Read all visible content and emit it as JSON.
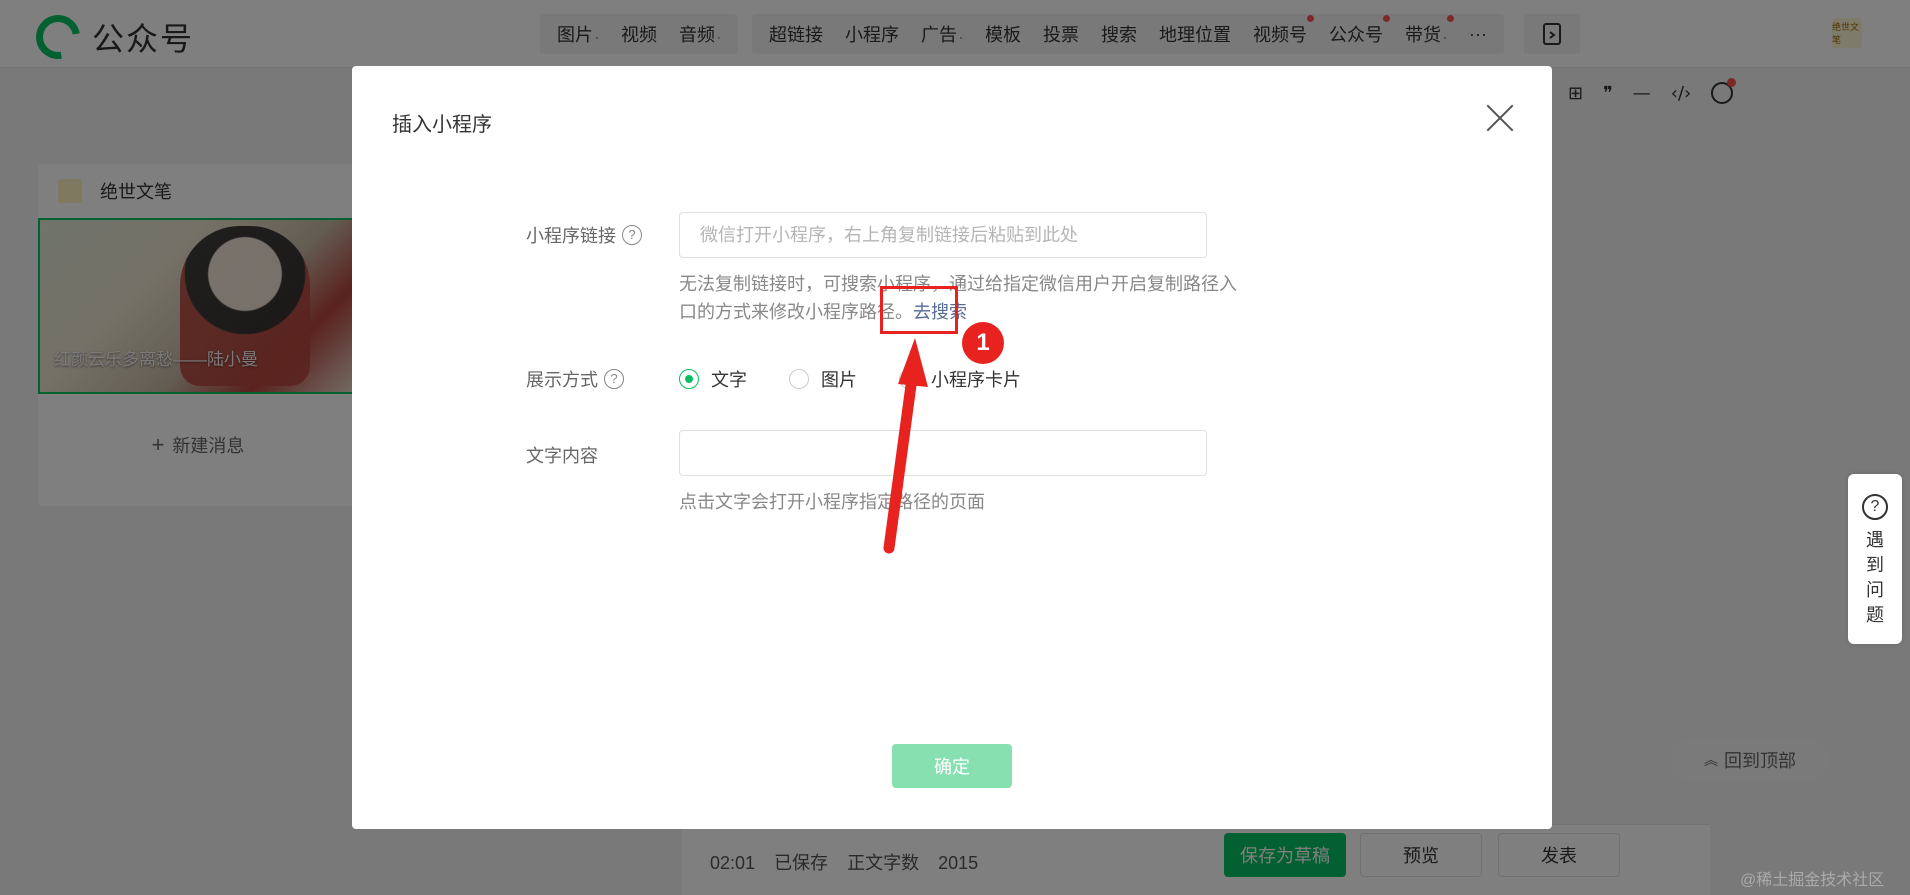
{
  "app": {
    "name": "公众号"
  },
  "toolbar": {
    "group1": [
      {
        "label": "图片",
        "caret": "·"
      },
      {
        "label": "视频",
        "caret": ""
      },
      {
        "label": "音频",
        "caret": "·"
      }
    ],
    "group2": [
      {
        "label": "超链接",
        "caret": ""
      },
      {
        "label": "小程序",
        "caret": ""
      },
      {
        "label": "广告",
        "caret": "·"
      },
      {
        "label": "模板",
        "caret": ""
      },
      {
        "label": "投票",
        "caret": ""
      },
      {
        "label": "搜索",
        "caret": ""
      },
      {
        "label": "地理位置",
        "caret": ""
      },
      {
        "label": "视频号",
        "caret": "",
        "dot": true
      },
      {
        "label": "公众号",
        "caret": "",
        "dot": true
      },
      {
        "label": "带货",
        "caret": "·",
        "dot": true
      },
      {
        "label": "···",
        "caret": ""
      }
    ],
    "user_avatar_text": "绝世文笔"
  },
  "format_bar": [
    "⊞",
    "❞",
    "—",
    "‹/›"
  ],
  "left_panel": {
    "account_name": "绝世文笔",
    "article_title": "红颜云乐多离愁——陆小曼",
    "new_message": "新建消息"
  },
  "help_tab": {
    "icon": "?",
    "text": "遇到问题"
  },
  "back_top": "回到顶部",
  "bottom_bar": {
    "time": "02:01",
    "saved": "已保存",
    "word_count_label": "正文字数",
    "word_count": "2015",
    "save_draft": "保存为草稿",
    "preview": "预览",
    "publish": "发表"
  },
  "watermark": "@稀土掘金技术社区",
  "modal": {
    "title": "插入小程序",
    "link_label": "小程序链接",
    "link_placeholder": "微信打开小程序，右上角复制链接后粘贴到此处",
    "tip_text": "无法复制链接时，可搜索小程序，通过给指定微信用户开启复制路径入口的方式来修改小程序路径。",
    "search_link": "去搜索",
    "display_label": "展示方式",
    "display_options": [
      {
        "label": "文字",
        "checked": true
      },
      {
        "label": "图片",
        "checked": false
      },
      {
        "label": "小程序卡片",
        "checked": false
      }
    ],
    "text_label": "文字内容",
    "text_value": "",
    "text_hint": "点击文字会打开小程序指定路径的页面",
    "confirm": "确定"
  },
  "annotation": {
    "number": "1",
    "color": "#e8231f"
  },
  "colors": {
    "brand": "#07c160",
    "link": "#576b95",
    "confirm_disabled": "#87e0b0",
    "annotation": "#e8231f"
  }
}
